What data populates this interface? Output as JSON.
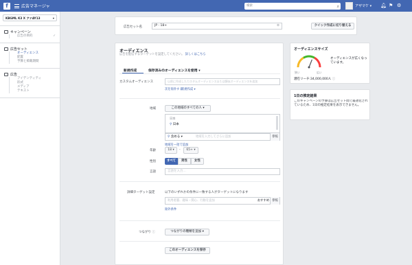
{
  "topbar": {
    "logo": "f",
    "app_title": "広告マネージャ",
    "search_placeholder": "検索",
    "user_name": "アザマケ ▾",
    "icons": [
      "bell-icon",
      "flag-icon",
      "help-icon",
      "gear-icon"
    ]
  },
  "sidebar": {
    "account": "KBGML K3 X アドAY13",
    "sections": [
      {
        "title": "キャンペーン",
        "icon": "campaign-icon",
        "items": [
          {
            "label": "広告の目的",
            "done": "✓"
          }
        ]
      },
      {
        "title": "広告セット",
        "icon": "adset-icon",
        "items": [
          {
            "label": "オーディエンス"
          },
          {
            "label": "配置"
          },
          {
            "label": "予算と掲載期間"
          }
        ]
      },
      {
        "title": "広告",
        "icon": "ad-icon",
        "items": [
          {
            "label": "アイデンティティ"
          },
          {
            "label": "形式"
          },
          {
            "label": "メディア"
          },
          {
            "label": "テキスト"
          }
        ]
      }
    ]
  },
  "adset_name": {
    "label": "広告セット名",
    "value": "JP - 18+",
    "quick_button": "クイック作成に切り替える"
  },
  "audience": {
    "title": "オーディエンス",
    "subtitle": "広告を配信するターゲットを設定してください。",
    "subtitle_link": "詳しくはこちら",
    "tabs": [
      "新規作成",
      "保存済みのオーディエンスを使用 ▾"
    ],
    "custom": {
      "label": "カスタムオーディエンス",
      "placeholder": "以前に作成したカスタムオーディエンスまたは類似オーディエンスを追加",
      "link_exclude": "次を除外する",
      "link_new": "新規作成 ▾"
    },
    "location": {
      "label": "地域",
      "scope": "この地域のすべての人 ▾",
      "country_header": "日本",
      "country_item": "日本",
      "include": "含める ▾",
      "placeholder": "地域を入力してさらに追加",
      "browse": "参照",
      "bulk_link": "地域を一括で追加"
    },
    "age": {
      "label": "年齢",
      "min": "18 ▾",
      "dash": "-",
      "max": "65+ ▾"
    },
    "gender": {
      "label": "性別",
      "options": [
        "すべて",
        "男性",
        "女性"
      ]
    },
    "language": {
      "label": "言語",
      "placeholder": "言語を入力..."
    },
    "detailed": {
      "label": "詳細ターゲット設定",
      "info": "以下のいずれかの条件に一致する人がターゲットになります",
      "placeholder": "利用者層、趣味・関心、行動を追加",
      "suggest": "おすすめ",
      "browse": "参照",
      "exclude_link": "除外条件"
    },
    "connections": {
      "label": "つながり",
      "value": "つながりの種類を追加 ▾"
    },
    "save_button": "このオーディエンスを保存"
  },
  "size_card": {
    "title": "オーディエンスサイズ",
    "description": "オーディエンスが広くなっています。",
    "low": "狭い",
    "high": "広い",
    "reach": "潜在リーチ:34,000,000人",
    "gauge_level": 0.62
  },
  "estimate_card": {
    "title": "1日の推定結果",
    "text": "このキャンペーンの予算は広告セット間で最適化されているため、1日の推定結果を表示できません。"
  }
}
